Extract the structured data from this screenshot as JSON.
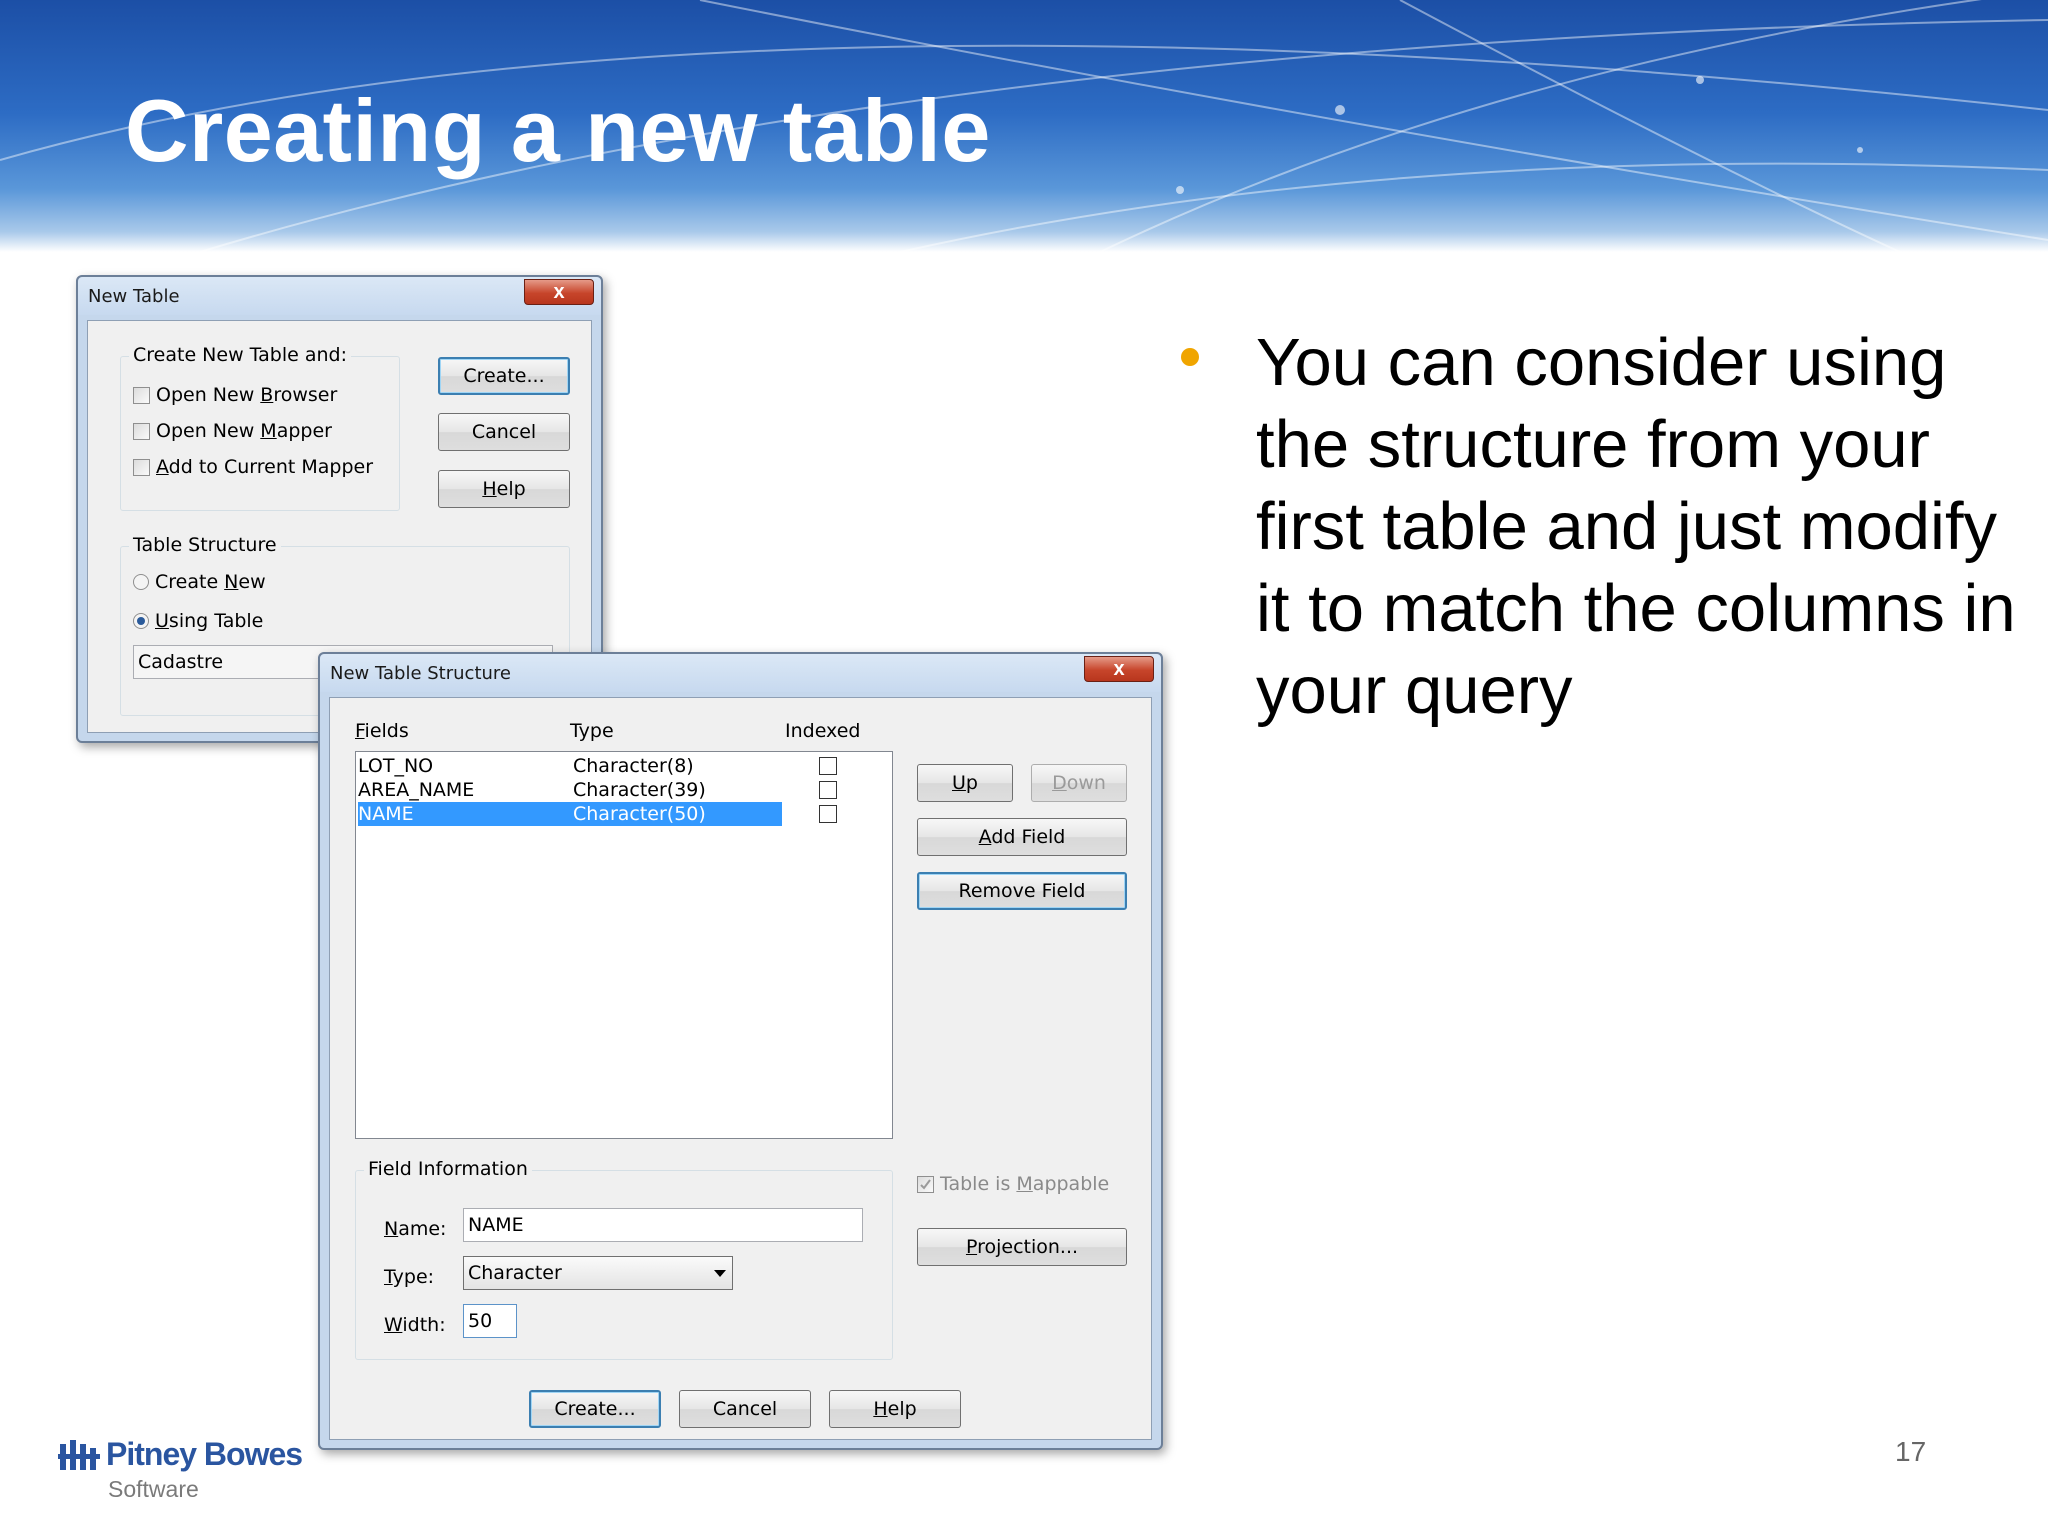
{
  "slide": {
    "title": "Creating a new table",
    "bullet": "You can consider using the structure from your first table and just modify it to match the columns in your query",
    "page_number": "17",
    "accent_color": "#f0a500",
    "logo": {
      "name": "Pitney Bowes",
      "sub": "Software",
      "icon": "pitney-bowes-logo-icon"
    }
  },
  "new_table_dialog": {
    "title": "New Table",
    "close_label": "x",
    "group_create": {
      "legend": "Create New Table and:",
      "options": [
        {
          "pre": "Open New ",
          "ul": "B",
          "post": "rowser",
          "checked": false
        },
        {
          "pre": "Open New ",
          "ul": "M",
          "post": "apper",
          "checked": false
        },
        {
          "pre": "",
          "ul": "A",
          "post": "dd to Current Mapper",
          "checked": false
        }
      ]
    },
    "buttons": {
      "create": "Create...",
      "cancel": "Cancel",
      "help_ul": "H",
      "help_rest": "elp"
    },
    "group_structure": {
      "legend": "Table Structure",
      "create_new_pre": "Create ",
      "create_new_ul": "N",
      "create_new_post": "ew",
      "using_ul": "U",
      "using_post": "sing Table",
      "selected": "using_table",
      "table_value": "Cadastre"
    }
  },
  "structure_dialog": {
    "title": "New Table Structure",
    "close_label": "x",
    "columns": {
      "fields_ul": "F",
      "fields_rest": "ields",
      "type": "Type",
      "indexed": "Indexed"
    },
    "rows": [
      {
        "field": "LOT_NO",
        "type": "Character(8)",
        "indexed": false,
        "selected": false
      },
      {
        "field": "AREA_NAME",
        "type": "Character(39)",
        "indexed": false,
        "selected": false
      },
      {
        "field": "NAME",
        "type": "Character(50)",
        "indexed": false,
        "selected": true
      }
    ],
    "side_buttons": {
      "up_ul": "U",
      "up_rest": "p",
      "down_ul": "D",
      "down_rest": "own",
      "add_ul": "A",
      "add_rest": "dd Field",
      "remove": "Remove Field",
      "projection_ul": "P",
      "projection_rest": "rojection..."
    },
    "mappable": {
      "pre": "Table is ",
      "ul": "M",
      "post": "appable",
      "checked": true
    },
    "field_info": {
      "legend": "Field Information",
      "name_ul": "N",
      "name_rest": "ame:",
      "name_value": "NAME",
      "type_ul": "T",
      "type_rest": "ype:",
      "type_value": "Character",
      "width_ul": "W",
      "width_rest": "idth:",
      "width_value": "50"
    },
    "bottom_buttons": {
      "create": "Create...",
      "cancel": "Cancel",
      "help_ul": "H",
      "help_rest": "elp"
    }
  }
}
